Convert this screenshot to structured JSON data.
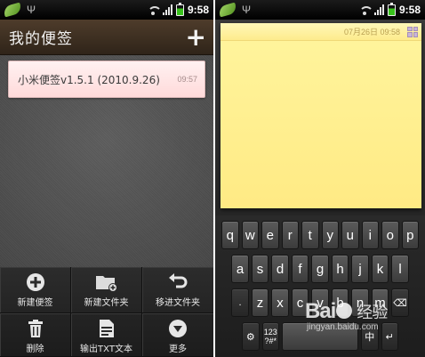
{
  "status_bar": {
    "time": "9:58"
  },
  "left": {
    "app_title": "我的便签",
    "add_symbol": "+",
    "note": {
      "title": "小米便签v1.5.1 (2010.9.26)",
      "time": "09:57"
    },
    "menu": [
      {
        "label": "新建便签",
        "icon": "plus-circle-icon"
      },
      {
        "label": "新建文件夹",
        "icon": "new-folder-icon"
      },
      {
        "label": "移进文件夹",
        "icon": "undo-arrow-icon"
      },
      {
        "label": "删除",
        "icon": "trash-icon"
      },
      {
        "label": "输出TXT文本",
        "icon": "txt-file-icon"
      },
      {
        "label": "更多",
        "icon": "chevron-down-circle-icon"
      }
    ]
  },
  "right": {
    "editor": {
      "date": "07月26日 09:58",
      "icon": "grid-icon"
    },
    "keyboard": {
      "row1": [
        "q",
        "w",
        "e",
        "r",
        "t",
        "y",
        "u",
        "i",
        "o",
        "p"
      ],
      "row2": [
        "a",
        "s",
        "d",
        "f",
        "g",
        "h",
        "j",
        "k",
        "l"
      ],
      "row3_left": ".",
      "row3": [
        "z",
        "x",
        "c",
        "v",
        "b",
        "n",
        "m"
      ],
      "row3_right": "⌫",
      "bottom": {
        "settings": "⚙",
        "num_top": "123",
        "num_bottom": "?#*",
        "mode_label": "中",
        "enter": "↵"
      }
    }
  },
  "watermark": {
    "brand_left": "Bai",
    "brand_right": "经验",
    "site": "jingyan.baidu.com"
  }
}
